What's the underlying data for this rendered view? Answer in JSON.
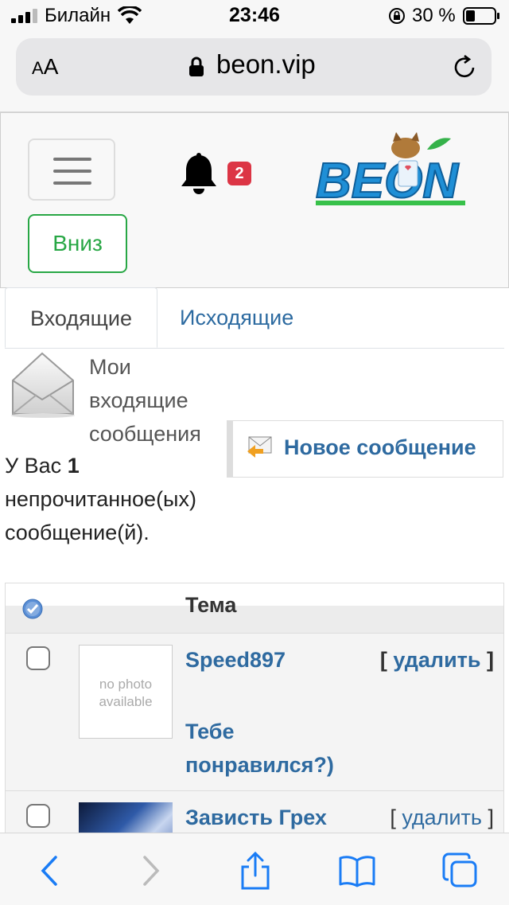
{
  "status_bar": {
    "carrier": "Билайн",
    "time": "23:46",
    "battery": "30 %"
  },
  "browser": {
    "aa_label_small": "A",
    "aa_label_big": "A",
    "url": "beon.vip"
  },
  "header": {
    "notification_count": "2",
    "down_button": "Вниз",
    "logo_text": "BEON"
  },
  "tabs": [
    {
      "label": "Входящие",
      "active": true
    },
    {
      "label": "Исходящие",
      "active": false
    }
  ],
  "inbox": {
    "title": "Мои входящие сообщения",
    "new_message_button": "Новое сообщение",
    "unread_prefix": "У Вас ",
    "unread_count": "1",
    "unread_suffix": " непрочитанное(ых) сообщение(й)."
  },
  "table": {
    "topic_header": "Тема",
    "rows": [
      {
        "sender": "Speed897",
        "subject": "Тебе понравился?)",
        "avatar": "no photo available",
        "delete_open": "[ ",
        "delete_label": "удалить",
        "delete_close": " ]"
      },
      {
        "sender": "Зависть Грех",
        "subject": "",
        "avatar": "",
        "delete_open": "[ ",
        "delete_label": "удалить",
        "delete_close": " ]"
      }
    ]
  },
  "colors": {
    "link": "#2e6aa0",
    "badge": "#dc3545",
    "success": "#28a745"
  },
  "icons": [
    "signal-icon",
    "wifi-icon",
    "lock-rotation-icon",
    "battery-icon",
    "lock-icon",
    "reload-icon",
    "menu-icon",
    "bell-icon",
    "envelope-icon",
    "new-message-icon",
    "check-all-icon",
    "back-icon",
    "forward-icon",
    "share-icon",
    "bookmarks-icon",
    "tabs-icon"
  ]
}
